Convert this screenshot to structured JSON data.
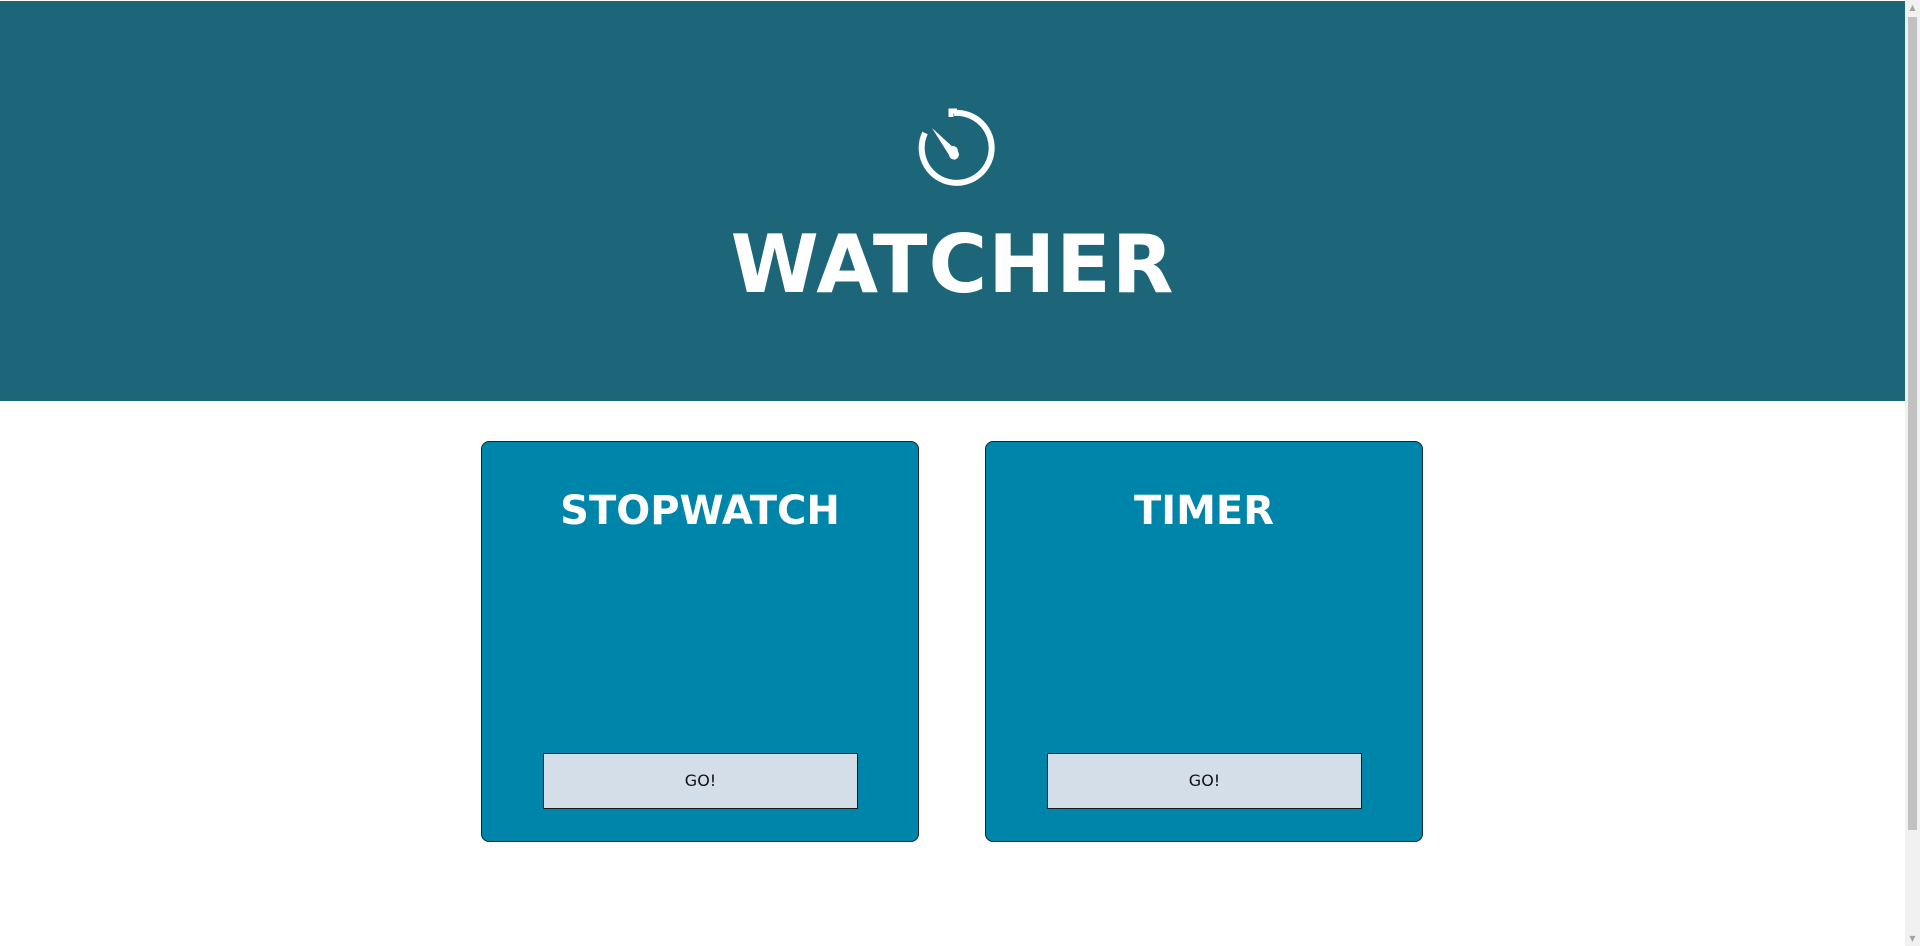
{
  "hero": {
    "icon": "stopwatch-icon",
    "title": "WATCHER",
    "background": "#1d6679"
  },
  "cards": [
    {
      "title": "STOPWATCH",
      "button_label": "GO!"
    },
    {
      "title": "TIMER",
      "button_label": "GO!"
    }
  ],
  "colors": {
    "card_bg": "#0085aa",
    "button_bg": "#d3dee9",
    "text_light": "#ffffff"
  },
  "scrollbar": {
    "up_arrow": "▲",
    "down_arrow": "▼"
  }
}
